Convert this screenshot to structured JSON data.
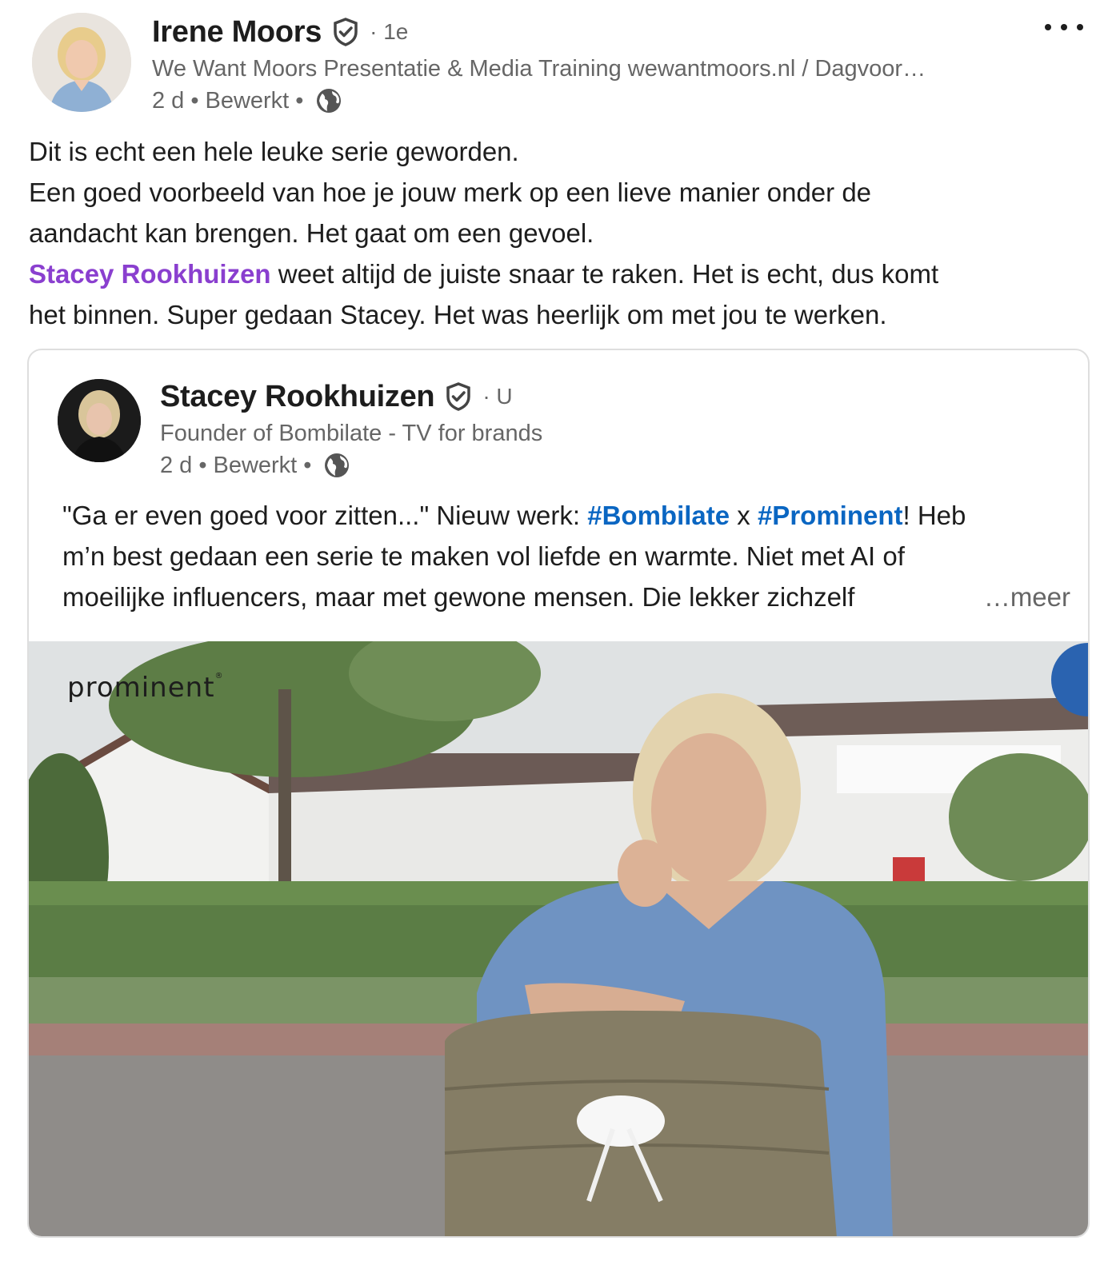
{
  "post": {
    "author": {
      "name": "Irene Moors",
      "degree": "· 1e",
      "headline": "We Want Moors Presentatie & Media Training wewantmoors.nl / Dagvoor…",
      "time": "2 d",
      "edited": "Bewerkt",
      "visibility_icon": "globe-icon"
    },
    "menu_icon": "more-horizontal-icon",
    "commentary": {
      "line1": "Dit is echt een hele leuke serie geworden.",
      "line2": "Een goed voorbeeld van hoe je jouw merk op een lieve manier onder de",
      "line3": "aandacht kan brengen. Het gaat om een gevoel.",
      "mention": "Stacey Rookhuizen",
      "line4_rest": " weet altijd de juiste snaar te raken. Het is echt, dus komt",
      "line5": "het binnen. Super gedaan Stacey. Het was heerlijk om met jou te werken."
    }
  },
  "reshared": {
    "author": {
      "name": "Stacey Rookhuizen",
      "degree": "· U",
      "headline": "Founder of Bombilate - TV for brands",
      "time": "2 d",
      "edited": "Bewerkt",
      "visibility_icon": "globe-icon"
    },
    "text": {
      "l1_a": "\"Ga er even goed voor zitten...\" Nieuw werk: ",
      "hashtag1": "#Bombilate",
      "l1_b": " x ",
      "hashtag2": "#Prominent",
      "l1_c": "! Heb",
      "line2": "m’n best gedaan een serie te maken vol liefde en warmte. Niet met AI of",
      "line3": "moeilijke influencers, maar met gewone mensen. Die lekker zichzelf",
      "see_more": "…meer"
    },
    "media": {
      "brand_logo": "prominent"
    }
  },
  "colors": {
    "mention": "#8a3fcf",
    "hashtag": "#0a66c2",
    "secondary_text": "#666666",
    "primary_text": "#1d1d1d"
  }
}
